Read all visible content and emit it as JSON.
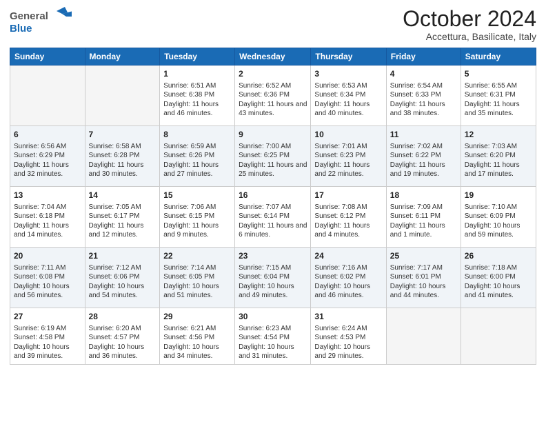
{
  "header": {
    "logo_general": "General",
    "logo_blue": "Blue",
    "month_title": "October 2024",
    "location": "Accettura, Basilicate, Italy"
  },
  "days_of_week": [
    "Sunday",
    "Monday",
    "Tuesday",
    "Wednesday",
    "Thursday",
    "Friday",
    "Saturday"
  ],
  "weeks": [
    [
      {
        "day": "",
        "sunrise": "",
        "sunset": "",
        "daylight": "",
        "empty": true
      },
      {
        "day": "",
        "sunrise": "",
        "sunset": "",
        "daylight": "",
        "empty": true
      },
      {
        "day": "1",
        "sunrise": "Sunrise: 6:51 AM",
        "sunset": "Sunset: 6:38 PM",
        "daylight": "Daylight: 11 hours and 46 minutes."
      },
      {
        "day": "2",
        "sunrise": "Sunrise: 6:52 AM",
        "sunset": "Sunset: 6:36 PM",
        "daylight": "Daylight: 11 hours and 43 minutes."
      },
      {
        "day": "3",
        "sunrise": "Sunrise: 6:53 AM",
        "sunset": "Sunset: 6:34 PM",
        "daylight": "Daylight: 11 hours and 40 minutes."
      },
      {
        "day": "4",
        "sunrise": "Sunrise: 6:54 AM",
        "sunset": "Sunset: 6:33 PM",
        "daylight": "Daylight: 11 hours and 38 minutes."
      },
      {
        "day": "5",
        "sunrise": "Sunrise: 6:55 AM",
        "sunset": "Sunset: 6:31 PM",
        "daylight": "Daylight: 11 hours and 35 minutes."
      }
    ],
    [
      {
        "day": "6",
        "sunrise": "Sunrise: 6:56 AM",
        "sunset": "Sunset: 6:29 PM",
        "daylight": "Daylight: 11 hours and 32 minutes."
      },
      {
        "day": "7",
        "sunrise": "Sunrise: 6:58 AM",
        "sunset": "Sunset: 6:28 PM",
        "daylight": "Daylight: 11 hours and 30 minutes."
      },
      {
        "day": "8",
        "sunrise": "Sunrise: 6:59 AM",
        "sunset": "Sunset: 6:26 PM",
        "daylight": "Daylight: 11 hours and 27 minutes."
      },
      {
        "day": "9",
        "sunrise": "Sunrise: 7:00 AM",
        "sunset": "Sunset: 6:25 PM",
        "daylight": "Daylight: 11 hours and 25 minutes."
      },
      {
        "day": "10",
        "sunrise": "Sunrise: 7:01 AM",
        "sunset": "Sunset: 6:23 PM",
        "daylight": "Daylight: 11 hours and 22 minutes."
      },
      {
        "day": "11",
        "sunrise": "Sunrise: 7:02 AM",
        "sunset": "Sunset: 6:22 PM",
        "daylight": "Daylight: 11 hours and 19 minutes."
      },
      {
        "day": "12",
        "sunrise": "Sunrise: 7:03 AM",
        "sunset": "Sunset: 6:20 PM",
        "daylight": "Daylight: 11 hours and 17 minutes."
      }
    ],
    [
      {
        "day": "13",
        "sunrise": "Sunrise: 7:04 AM",
        "sunset": "Sunset: 6:18 PM",
        "daylight": "Daylight: 11 hours and 14 minutes."
      },
      {
        "day": "14",
        "sunrise": "Sunrise: 7:05 AM",
        "sunset": "Sunset: 6:17 PM",
        "daylight": "Daylight: 11 hours and 12 minutes."
      },
      {
        "day": "15",
        "sunrise": "Sunrise: 7:06 AM",
        "sunset": "Sunset: 6:15 PM",
        "daylight": "Daylight: 11 hours and 9 minutes."
      },
      {
        "day": "16",
        "sunrise": "Sunrise: 7:07 AM",
        "sunset": "Sunset: 6:14 PM",
        "daylight": "Daylight: 11 hours and 6 minutes."
      },
      {
        "day": "17",
        "sunrise": "Sunrise: 7:08 AM",
        "sunset": "Sunset: 6:12 PM",
        "daylight": "Daylight: 11 hours and 4 minutes."
      },
      {
        "day": "18",
        "sunrise": "Sunrise: 7:09 AM",
        "sunset": "Sunset: 6:11 PM",
        "daylight": "Daylight: 11 hours and 1 minute."
      },
      {
        "day": "19",
        "sunrise": "Sunrise: 7:10 AM",
        "sunset": "Sunset: 6:09 PM",
        "daylight": "Daylight: 10 hours and 59 minutes."
      }
    ],
    [
      {
        "day": "20",
        "sunrise": "Sunrise: 7:11 AM",
        "sunset": "Sunset: 6:08 PM",
        "daylight": "Daylight: 10 hours and 56 minutes."
      },
      {
        "day": "21",
        "sunrise": "Sunrise: 7:12 AM",
        "sunset": "Sunset: 6:06 PM",
        "daylight": "Daylight: 10 hours and 54 minutes."
      },
      {
        "day": "22",
        "sunrise": "Sunrise: 7:14 AM",
        "sunset": "Sunset: 6:05 PM",
        "daylight": "Daylight: 10 hours and 51 minutes."
      },
      {
        "day": "23",
        "sunrise": "Sunrise: 7:15 AM",
        "sunset": "Sunset: 6:04 PM",
        "daylight": "Daylight: 10 hours and 49 minutes."
      },
      {
        "day": "24",
        "sunrise": "Sunrise: 7:16 AM",
        "sunset": "Sunset: 6:02 PM",
        "daylight": "Daylight: 10 hours and 46 minutes."
      },
      {
        "day": "25",
        "sunrise": "Sunrise: 7:17 AM",
        "sunset": "Sunset: 6:01 PM",
        "daylight": "Daylight: 10 hours and 44 minutes."
      },
      {
        "day": "26",
        "sunrise": "Sunrise: 7:18 AM",
        "sunset": "Sunset: 6:00 PM",
        "daylight": "Daylight: 10 hours and 41 minutes."
      }
    ],
    [
      {
        "day": "27",
        "sunrise": "Sunrise: 6:19 AM",
        "sunset": "Sunset: 4:58 PM",
        "daylight": "Daylight: 10 hours and 39 minutes."
      },
      {
        "day": "28",
        "sunrise": "Sunrise: 6:20 AM",
        "sunset": "Sunset: 4:57 PM",
        "daylight": "Daylight: 10 hours and 36 minutes."
      },
      {
        "day": "29",
        "sunrise": "Sunrise: 6:21 AM",
        "sunset": "Sunset: 4:56 PM",
        "daylight": "Daylight: 10 hours and 34 minutes."
      },
      {
        "day": "30",
        "sunrise": "Sunrise: 6:23 AM",
        "sunset": "Sunset: 4:54 PM",
        "daylight": "Daylight: 10 hours and 31 minutes."
      },
      {
        "day": "31",
        "sunrise": "Sunrise: 6:24 AM",
        "sunset": "Sunset: 4:53 PM",
        "daylight": "Daylight: 10 hours and 29 minutes."
      },
      {
        "day": "",
        "sunrise": "",
        "sunset": "",
        "daylight": "",
        "empty": true
      },
      {
        "day": "",
        "sunrise": "",
        "sunset": "",
        "daylight": "",
        "empty": true
      }
    ]
  ]
}
